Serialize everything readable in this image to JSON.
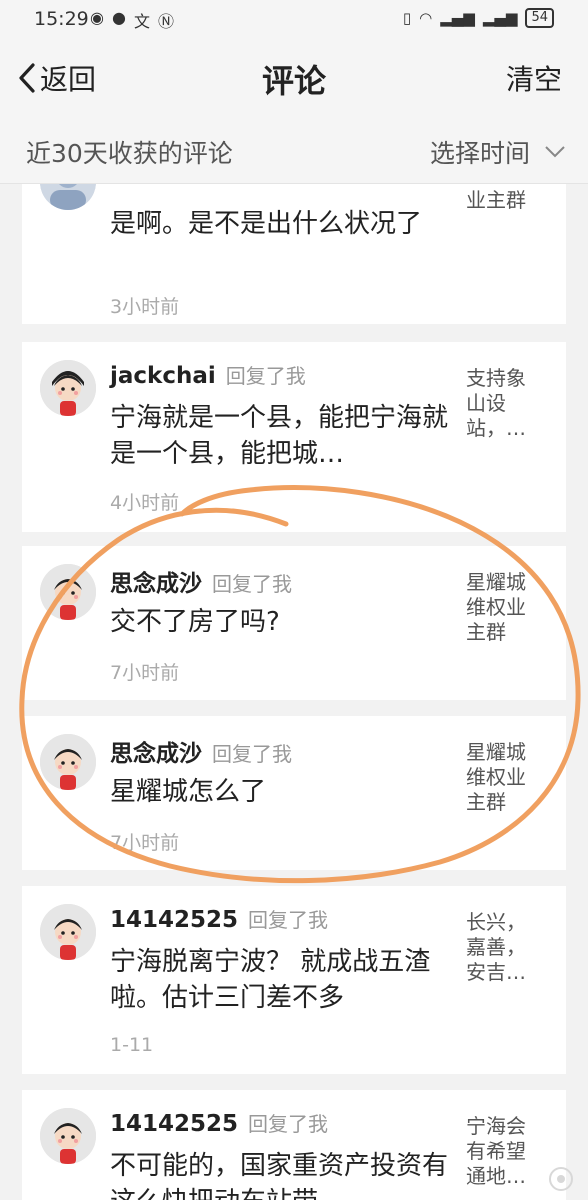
{
  "status": {
    "time": "15:29",
    "battery": "54"
  },
  "nav": {
    "back_label": "返回",
    "title": "评论",
    "clear_label": "清空"
  },
  "filter": {
    "label": "近30天收获的评论",
    "select_label": "选择时间"
  },
  "comments": [
    {
      "username": "",
      "reply_tag": "",
      "text": "是啊。是不是出什么状况了",
      "time": "3小时前",
      "source": "业主群"
    },
    {
      "username": "jackchai",
      "reply_tag": "回复了我",
      "text": "宁海就是一个县，能把宁海就是一个县，能把城…",
      "time": "4小时前",
      "source": "支持象山设站，…"
    },
    {
      "username": "思念成沙",
      "reply_tag": "回复了我",
      "text": "交不了房了吗?",
      "time": "7小时前",
      "source": "星耀城维权业主群"
    },
    {
      "username": "思念成沙",
      "reply_tag": "回复了我",
      "text": "星耀城怎么了",
      "time": "7小时前",
      "source": "星耀城维权业主群"
    },
    {
      "username": "14142525",
      "reply_tag": "回复了我",
      "text": "宁海脱离宁波？ 就成战五渣啦。估计三门差不多",
      "time": "1-11",
      "source": "长兴，嘉善，安吉…"
    },
    {
      "username": "14142525",
      "reply_tag": "回复了我",
      "text": "不可能的，国家重资产投资有这么快把动车站带",
      "time": "",
      "source": "宁海会有希望通地…"
    }
  ],
  "colors": {
    "annotation_circle": "#f0a060",
    "background": "#f2f2f2",
    "card": "#ffffff"
  }
}
